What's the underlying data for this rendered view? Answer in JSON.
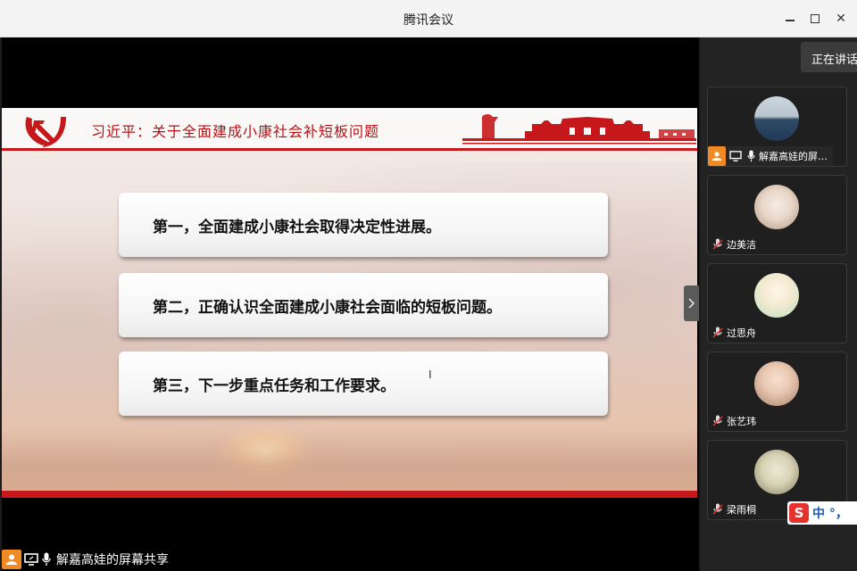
{
  "app": {
    "title": "腾讯会议"
  },
  "slide": {
    "title": "习近平：关于全面建成小康社会补短板问题",
    "points": [
      "第一，全面建成小康社会取得决定性进展。",
      "第二，正确认识全面建成小康社会面临的短板问题。",
      "第三，下一步重点任务和工作要求。"
    ]
  },
  "share_bar": {
    "label": "解嘉高娃的屏幕共享"
  },
  "speaking": {
    "label": "正在讲话"
  },
  "participants": [
    {
      "name": "解嘉高娃的屏幕共享",
      "avatar_icon": "ocean-photo-avatar",
      "mic": "on"
    },
    {
      "name": "边美洁",
      "avatar_icon": "plush-toy-avatar",
      "mic": "off"
    },
    {
      "name": "过思舟",
      "avatar_icon": "cartoon-avatar",
      "mic": "off"
    },
    {
      "name": "张艺玮",
      "avatar_icon": "portrait-avatar",
      "mic": "off"
    },
    {
      "name": "梁雨桐",
      "avatar_icon": "figure-avatar",
      "mic": "off"
    }
  ],
  "ime": {
    "label": "中 °，"
  }
}
